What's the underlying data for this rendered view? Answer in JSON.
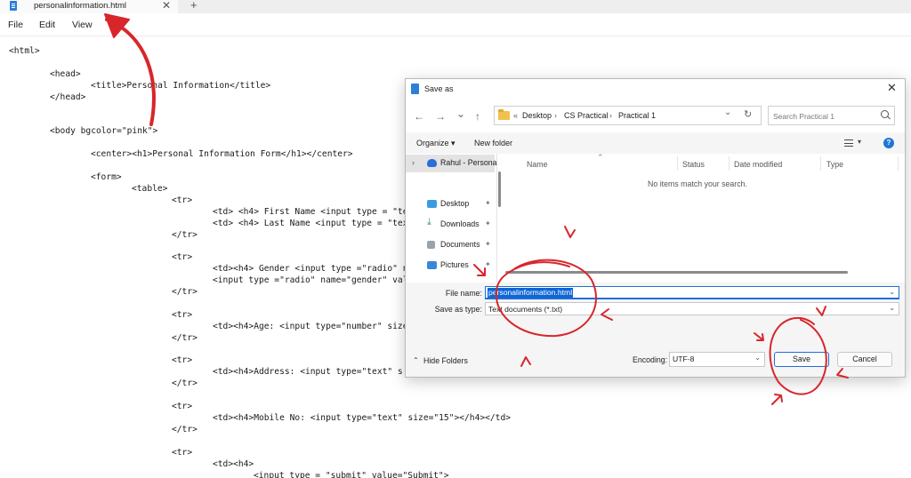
{
  "notepad": {
    "tab_title": "personalinformation.html",
    "tab_close_glyph": "✕",
    "new_tab_glyph": "+",
    "menu": [
      "File",
      "Edit",
      "View"
    ],
    "code": [
      "<html>",
      "<head>",
      "<title>Personal Information</title>",
      "</head>",
      "<body bgcolor=\"pink\">",
      "<center><h1>Personal Information Form</h1></center>",
      "<form>",
      "<table>",
      "<tr>",
      "<td> <h4> First Name <input type = \"te",
      "<td> <h4> Last Name <input type = \"tex",
      "</tr>",
      "<tr>",
      "<td><h4> Gender <input type =\"radio\" n",
      "<input type =\"radio\" name=\"gender\" val",
      "</tr>",
      "<tr>",
      "<td><h4>Age: <input type=\"number\" size",
      "</tr>",
      "<tr>",
      "<td><h4>Address: <input type=\"text\" s",
      "</tr>",
      "<tr>",
      "<td><h4>Mobile No: <input type=\"text\" size=\"15\"></h4></td>",
      "</tr>",
      "<tr>",
      "<td><h4>",
      "<input type = \"submit\" value=\"Submit\">"
    ]
  },
  "dialog": {
    "title": "Save as",
    "close_glyph": "✕",
    "nav": {
      "back": "←",
      "forward": "→",
      "recent": "⌄",
      "up": "↑"
    },
    "breadcrumb": {
      "overflow": "«",
      "items": [
        "Desktop",
        "CS Practical",
        "Practical 1"
      ],
      "separator": "›"
    },
    "address_dropdown": "⌄",
    "refresh_glyph": "↻",
    "search_placeholder": "Search Practical 1",
    "toolbar": {
      "organize": "Organize ▾",
      "new_folder": "New folder",
      "view_dropdown": "▾",
      "help": "?"
    },
    "nav_pane": [
      {
        "label": "Rahul - Persona",
        "icon": "cloud-icon",
        "chevron": "›"
      },
      {
        "label": "Desktop",
        "icon": "desktop-icon",
        "pinned": true
      },
      {
        "label": "Downloads",
        "icon": "download-icon",
        "pinned": true
      },
      {
        "label": "Documents",
        "icon": "documents-icon",
        "pinned": true
      },
      {
        "label": "Pictures",
        "icon": "pictures-icon",
        "pinned": true
      }
    ],
    "pin_glyph": "📌",
    "columns": [
      "Name",
      "Status",
      "Date modified",
      "Type"
    ],
    "sort_glyph": "⌃",
    "empty_message": "No items match your search.",
    "file_name_label": "File name:",
    "file_name_value": "personalinformation.html",
    "save_type_label": "Save as type:",
    "save_type_value": "Text documents (*.txt)",
    "dropdown_glyph": "⌄",
    "hide_folders_glyph": "⌃",
    "hide_folders": "Hide Folders",
    "encoding_label": "Encoding:",
    "encoding_value": "UTF-8",
    "save_button": "Save",
    "cancel_button": "Cancel"
  },
  "colors": {
    "annotation_red": "#d8262a",
    "selection_blue": "#0f66d4",
    "accent_blue": "#1e6ed8"
  }
}
